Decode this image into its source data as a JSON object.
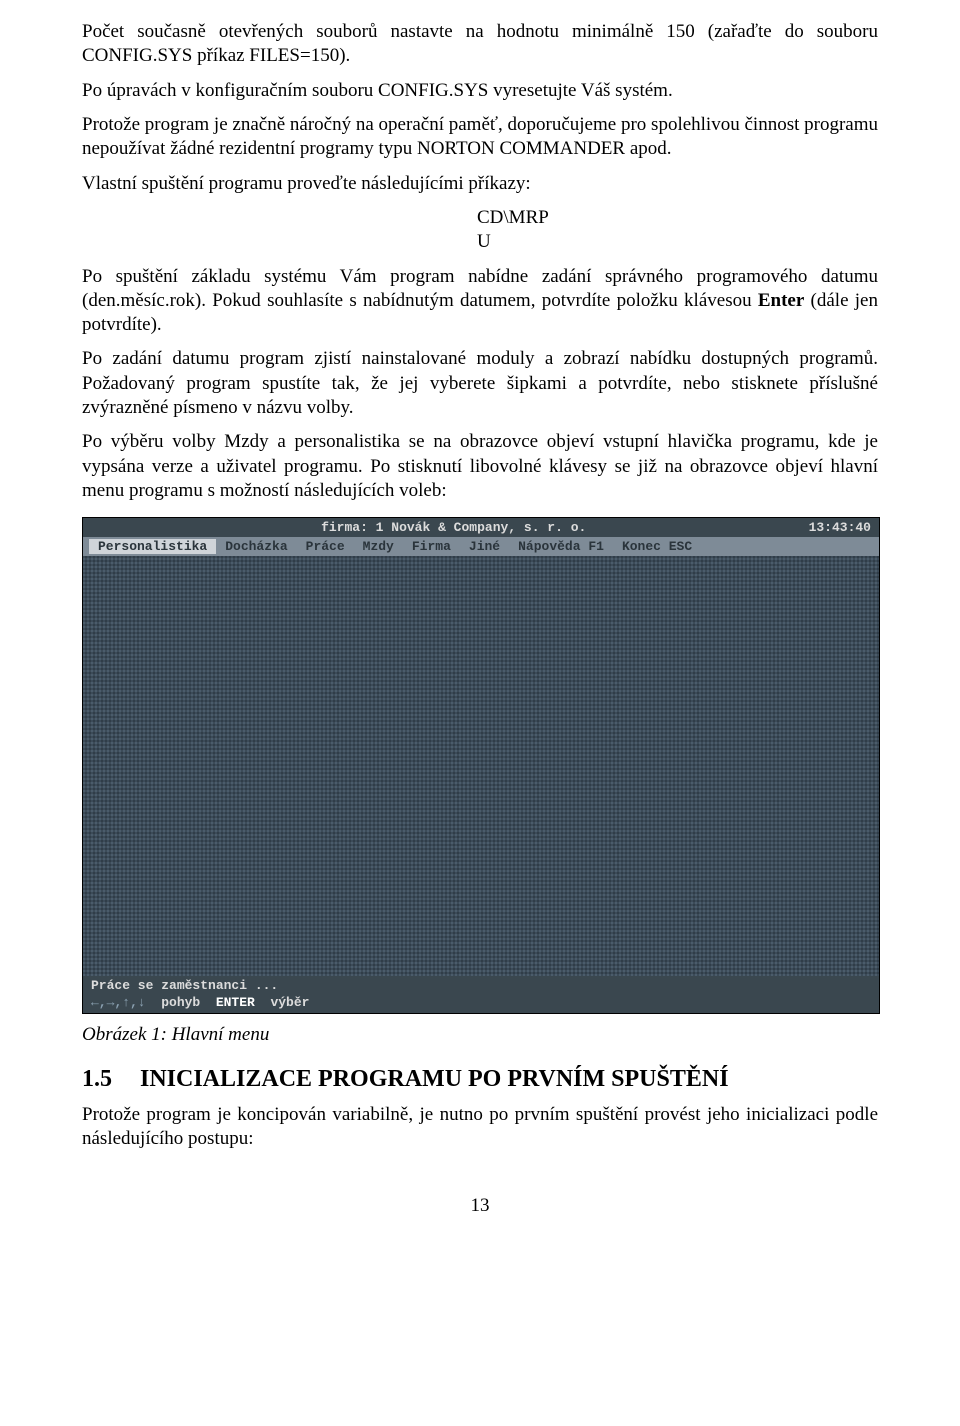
{
  "para": {
    "p1": "Počet současně otevřených souborů nastavte na hodnotu minimálně 150 (zařaďte do souboru CONFIG.SYS příkaz FILES=150).",
    "p2": "Po úpravách v konfiguračním souboru CONFIG.SYS vyresetujte Váš systém.",
    "p3": "Protože program je značně náročný na operační paměť, doporučujeme pro spolehlivou činnost programu nepoužívat žádné rezidentní programy typu NORTON COMMANDER apod.",
    "p4": "Vlastní spuštění programu proveďte následujícími příkazy:",
    "cmd1": "CD\\MRP",
    "cmd2": "U",
    "p5a": "Po spuštění základu systému Vám program nabídne zadání správného programového datumu (den.měsíc.rok). Pokud souhlasíte s nabídnutým datumem, potvrdíte položku klávesou ",
    "p5b_bold": "Enter",
    "p5c": " (dále jen potvrdíte).",
    "p6": "Po zadání datumu program zjistí nainstalované moduly a zobrazí nabídku dostupných programů. Požadovaný program spustíte tak, že jej vyberete šipkami a potvrdíte, nebo stisknete příslušné zvýrazněné písmeno v názvu volby.",
    "p7": "Po výběru volby Mzdy a personalistika se na obrazovce objeví vstupní hlavička programu, kde je vypsána verze a uživatel programu. Po stisknutí libovolné klávesy se již na obrazovce objeví hlavní menu programu s možností následujících voleb:"
  },
  "dos": {
    "title_center": "firma: 1  Novák & Company, s. r. o.",
    "title_time": "13:43:40",
    "menu": [
      "Personalistika",
      "Docházka",
      "Práce",
      "Mzdy",
      "Firma",
      "Jiné",
      "Nápověda F1",
      "Konec ESC"
    ],
    "status1": "Práce se zaměstnanci ...",
    "status2_arrows": "←,→,↑,↓",
    "status2_mid": "  pohyb  ",
    "status2_enter": "ENTER",
    "status2_end": "  výběr"
  },
  "caption": "Obrázek 1: Hlavní menu",
  "section": {
    "num": "1.5",
    "title": "INICIALIZACE PROGRAMU PO PRVNÍM SPUŠTĚNÍ"
  },
  "para2": {
    "p8": "Protože program je koncipován variabilně, je nutno po prvním spuštění provést jeho inicializaci podle následujícího postupu:"
  },
  "pagenum": "13"
}
